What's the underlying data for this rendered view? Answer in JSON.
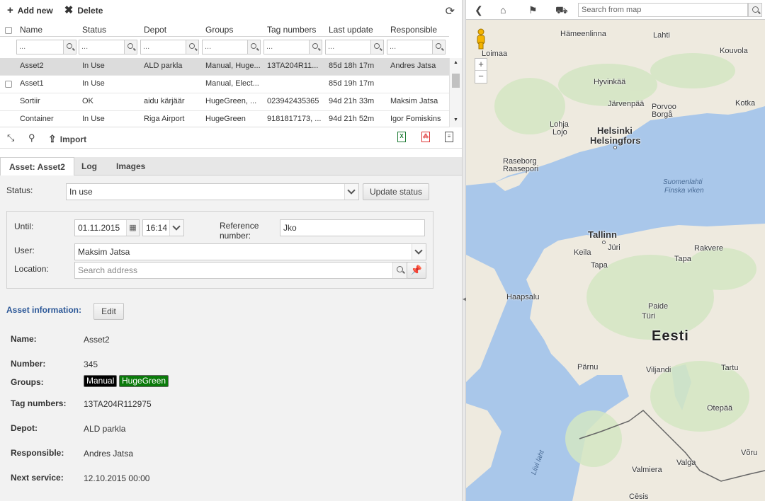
{
  "toolbar": {
    "add_label": "Add new",
    "delete_label": "Delete"
  },
  "grid": {
    "columns": [
      "Name",
      "Status",
      "Depot",
      "Groups",
      "Tag numbers",
      "Last update",
      "Responsible"
    ],
    "filter_placeholder": "...",
    "rows": [
      {
        "name": "Asset2",
        "status": "In Use",
        "depot": "ALD parkla",
        "groups": "Manual, Huge...",
        "tags": "13TA204R11...",
        "last_update": "85d 18h 17m",
        "responsible": "Andres Jatsa",
        "selected": true
      },
      {
        "name": "Asset1",
        "status": "In Use",
        "depot": "",
        "groups": "Manual, Elect...",
        "tags": "",
        "last_update": "85d 19h 17m",
        "responsible": ""
      },
      {
        "name": "Sortiir",
        "status": "OK",
        "depot": "aidu kärjäär",
        "groups": "HugeGreen, ...",
        "tags": "023942435365",
        "last_update": "94d 21h 33m",
        "responsible": "Maksim Jatsa"
      },
      {
        "name": "Container",
        "status": "In Use",
        "depot": "Riga Airport",
        "groups": "HugeGreen",
        "tags": "9181817173, ...",
        "last_update": "94d 21h 52m",
        "responsible": "Igor Fomiskins"
      }
    ]
  },
  "gridbar": {
    "import_label": "Import"
  },
  "tabs": [
    "Asset: Asset2",
    "Log",
    "Images"
  ],
  "form": {
    "status_label": "Status:",
    "status_value": "In use",
    "update_status_label": "Update status",
    "until_label": "Until:",
    "until_date": "01.11.2015",
    "until_time": "16:14",
    "reference_label_1": "Reference",
    "reference_label_2": "number:",
    "reference_value": "Jko",
    "user_label": "User:",
    "user_value": "Maksim Jatsa",
    "location_label": "Location:",
    "location_placeholder": "Search address"
  },
  "info": {
    "title": "Asset information:",
    "edit_label": "Edit",
    "name_label": "Name:",
    "name_value": "Asset2",
    "number_label": "Number:",
    "number_value": "345",
    "groups_label": "Groups:",
    "groups": [
      {
        "label": "Manual",
        "color": "#000000"
      },
      {
        "label": "HugeGreen",
        "color": "#0a7a0a"
      }
    ],
    "tags_label": "Tag numbers:",
    "tags_value": "13TA204R112975",
    "depot_label": "Depot:",
    "depot_value": "ALD parkla",
    "responsible_label": "Responsible:",
    "responsible_value": "Andres Jatsa",
    "service_label": "Next service:",
    "service_value": "12.10.2015 00:00"
  },
  "map": {
    "search_placeholder": "Search from map",
    "zoom_in": "+",
    "zoom_out": "−",
    "places": {
      "hameenlinna": "Hämeenlinna",
      "lahti": "Lahti",
      "loimaa": "Loimaa",
      "kouvola": "Kouvola",
      "hyvinkaa": "Hyvinkää",
      "jarvenpaa": "Järvenpää",
      "porvoo": "Porvoo",
      "borga": "Borgå",
      "kotka": "Kotka",
      "lohja": "Lohja",
      "lojo": "Lojo",
      "helsinki": "Helsinki",
      "helsingfors": "Helsingfors",
      "raseborg": "Raseborg",
      "raasepori": "Raasepori",
      "tallinn": "Tallinn",
      "juri": "Jüri",
      "keila": "Keila",
      "rakvere": "Rakvere",
      "tapa": "Tapa",
      "haapsalu": "Haapsalu",
      "paide": "Paide",
      "turi": "Türi",
      "eesti": "Eesti",
      "parnu": "Pärnu",
      "viljandi": "Viljandi",
      "tartu": "Tartu",
      "otepaa": "Otepää",
      "voru": "Võru",
      "valga": "Valga",
      "valmiera": "Valmiera",
      "cesis": "Cēsis"
    },
    "sea_1": "Suomenlahti",
    "sea_2": "Finska viken",
    "sea_3": "Liivi laht"
  }
}
